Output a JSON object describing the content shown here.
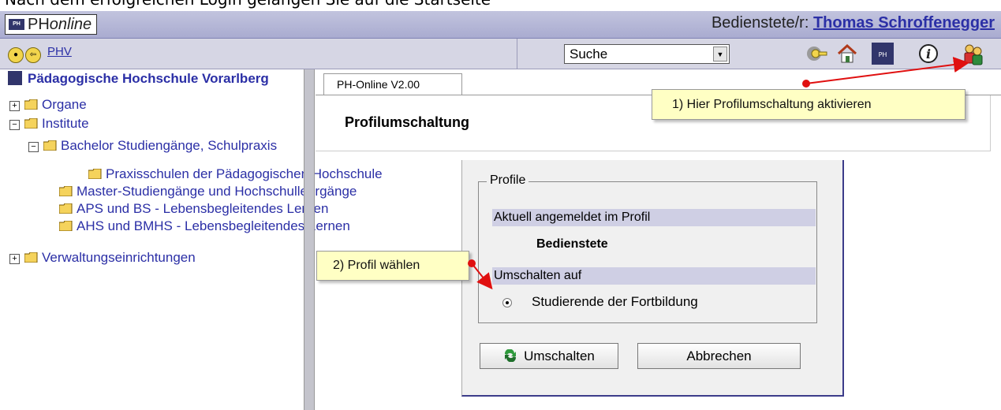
{
  "caption": "Nach dem erfolgreichen Login gelangen Sie auf die Startseite",
  "header": {
    "logo_prefix": "PH",
    "logo_suffix": "online",
    "user_label": "Bedienstete/r:",
    "user_name": "Thomas Schroffenegger"
  },
  "toolbar": {
    "home_link": "PHV",
    "search_select_value": "Suche",
    "icons": [
      "back-forward-icon",
      "key-icon",
      "home-icon",
      "ph-logo-icon",
      "info-icon",
      "profile-switch-icon"
    ]
  },
  "tree": {
    "root": "Pädagogische Hochschule Vorarlberg",
    "items": [
      {
        "label": "Organe",
        "expander": "+"
      },
      {
        "label": "Institute",
        "expander": "−"
      },
      {
        "label": "Bachelor Studiengänge, Schulpraxis",
        "expander": "−"
      },
      {
        "label": "Praxisschulen der Pädagogischen Hochschule"
      },
      {
        "label": "Master-Studiengänge und Hochschullehrgänge"
      },
      {
        "label": "APS und BS - Lebensbegleitendes Lernen"
      },
      {
        "label": "AHS und BMHS - Lebensbegleitendes Lernen"
      },
      {
        "label": "Verwaltungseinrichtungen",
        "expander": "+"
      }
    ]
  },
  "main": {
    "tab_label": "PH-Online V2.00",
    "page_title": "Profilumschaltung",
    "dialog": {
      "legend": "Profile",
      "current_heading": "Aktuell angemeldet im Profil",
      "current_profile": "Bedienstete",
      "switch_heading": "Umschalten auf",
      "switch_option": "Studierende der Fortbildung",
      "switch_button": "Umschalten",
      "cancel_button": "Abbrechen"
    }
  },
  "callouts": {
    "step1": "1) Hier Profilumschaltung aktivieren",
    "step2": "2) Profil wählen"
  },
  "colors": {
    "link": "#2b2fa6",
    "callout_bg": "#ffffc4",
    "arrow": "#e01010",
    "section_head": "#cfcfe4"
  }
}
